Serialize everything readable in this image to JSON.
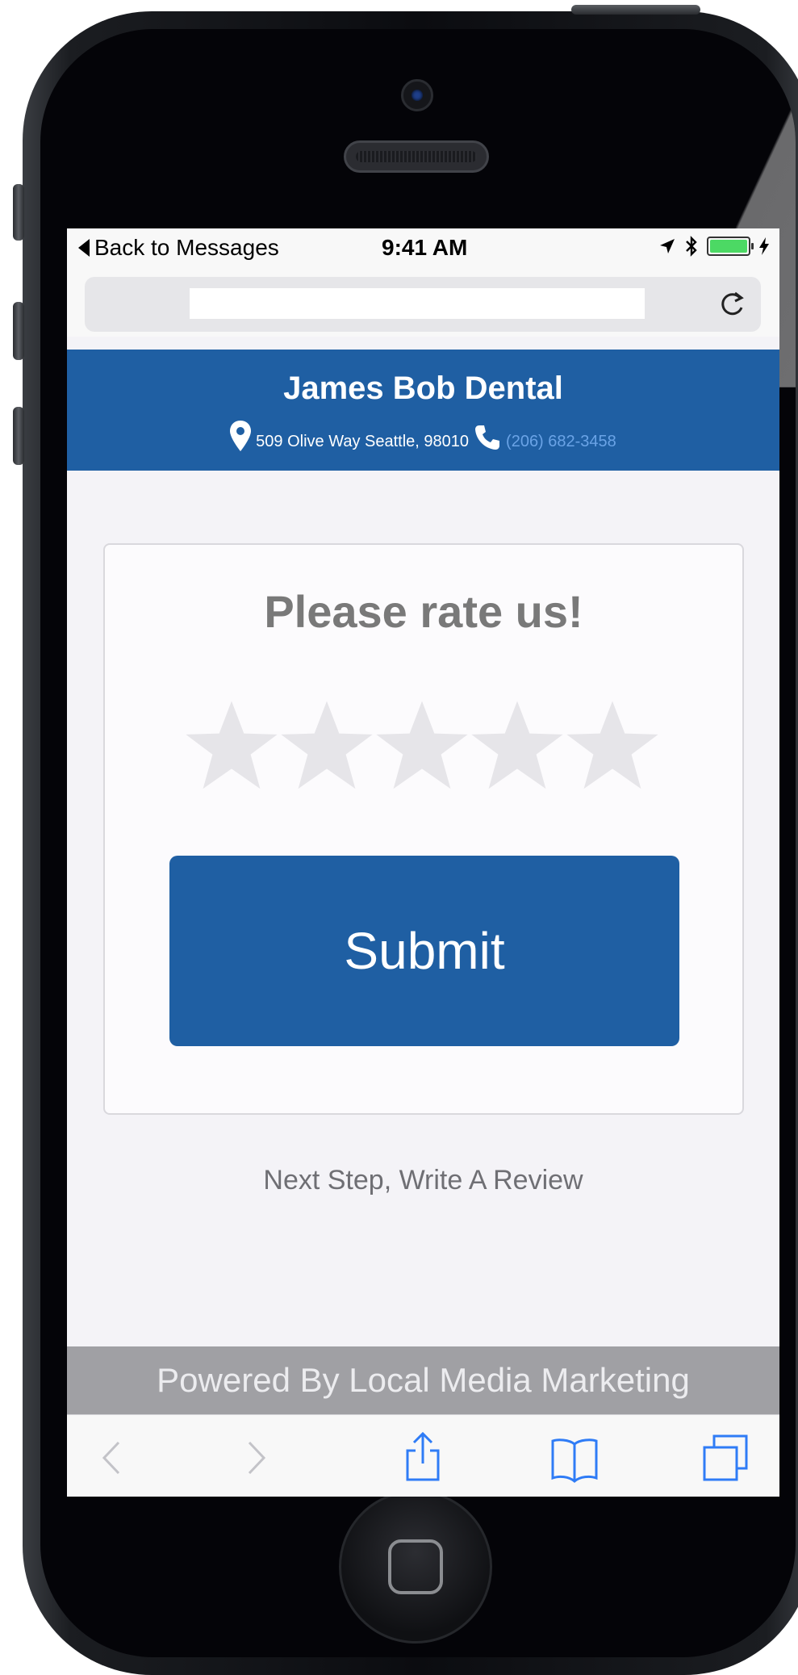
{
  "status_bar": {
    "back_label": "Back to Messages",
    "time": "9:41 AM",
    "battery_color": "#4cd964"
  },
  "url_bar": {
    "value": "",
    "reload_icon": "reload-icon"
  },
  "header": {
    "business_name": "James Bob Dental",
    "address": "509 Olive Way Seattle, 98010",
    "phone": "(206) 682-3458",
    "background_color": "#1f5fa3",
    "location_icon": "map-pin-icon",
    "phone_icon": "phone-icon"
  },
  "rating": {
    "title": "Please rate us!",
    "max_stars": 5,
    "selected_stars": 0,
    "star_color": "#e6e5e9",
    "submit_label": "Submit"
  },
  "next_step_label": "Next Step, Write A Review",
  "footer": {
    "powered_by": "Powered By Local Media Marketing"
  },
  "toolbar": {
    "items": [
      "back-arrow-icon",
      "forward-arrow-icon",
      "share-icon",
      "bookmarks-icon",
      "tabs-icon"
    ]
  }
}
